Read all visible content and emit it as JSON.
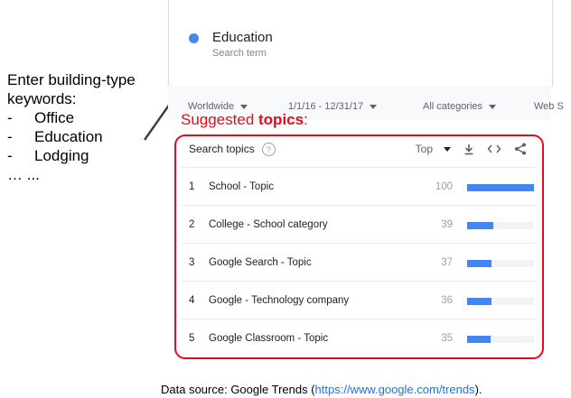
{
  "annotation": {
    "intro_line1": "Enter building-type",
    "intro_line2": "keywords:",
    "items": [
      "Office",
      "Education",
      "Lodging"
    ],
    "ellipsis": "… ..."
  },
  "search_term": {
    "name": "Education",
    "subtitle": "Search term",
    "color": "#4285f4"
  },
  "filters": {
    "region": "Worldwide",
    "date_range": "1/1/16 - 12/31/17",
    "category": "All categories",
    "search_type": "Web S"
  },
  "suggested": {
    "prefix": "Suggested ",
    "bold": "topics",
    "suffix": ":",
    "color": "#e8091a"
  },
  "topics_panel": {
    "title": "Search topics",
    "help_icon": "?",
    "sort": "Top",
    "rows": [
      {
        "rank": "1",
        "name": "School - Topic",
        "value": "100",
        "level": 1.0
      },
      {
        "rank": "2",
        "name": "College - School category",
        "value": "39",
        "level": 0.39
      },
      {
        "rank": "3",
        "name": "Google Search - Topic",
        "value": "37",
        "level": 0.37
      },
      {
        "rank": "4",
        "name": "Google - Technology company",
        "value": "36",
        "level": 0.36
      },
      {
        "rank": "5",
        "name": "Google Classroom - Topic",
        "value": "35",
        "level": 0.35
      }
    ]
  },
  "source": {
    "prefix": "Data source: Google Trends (",
    "url": "https://www.google.com/trends",
    "suffix": ")."
  }
}
